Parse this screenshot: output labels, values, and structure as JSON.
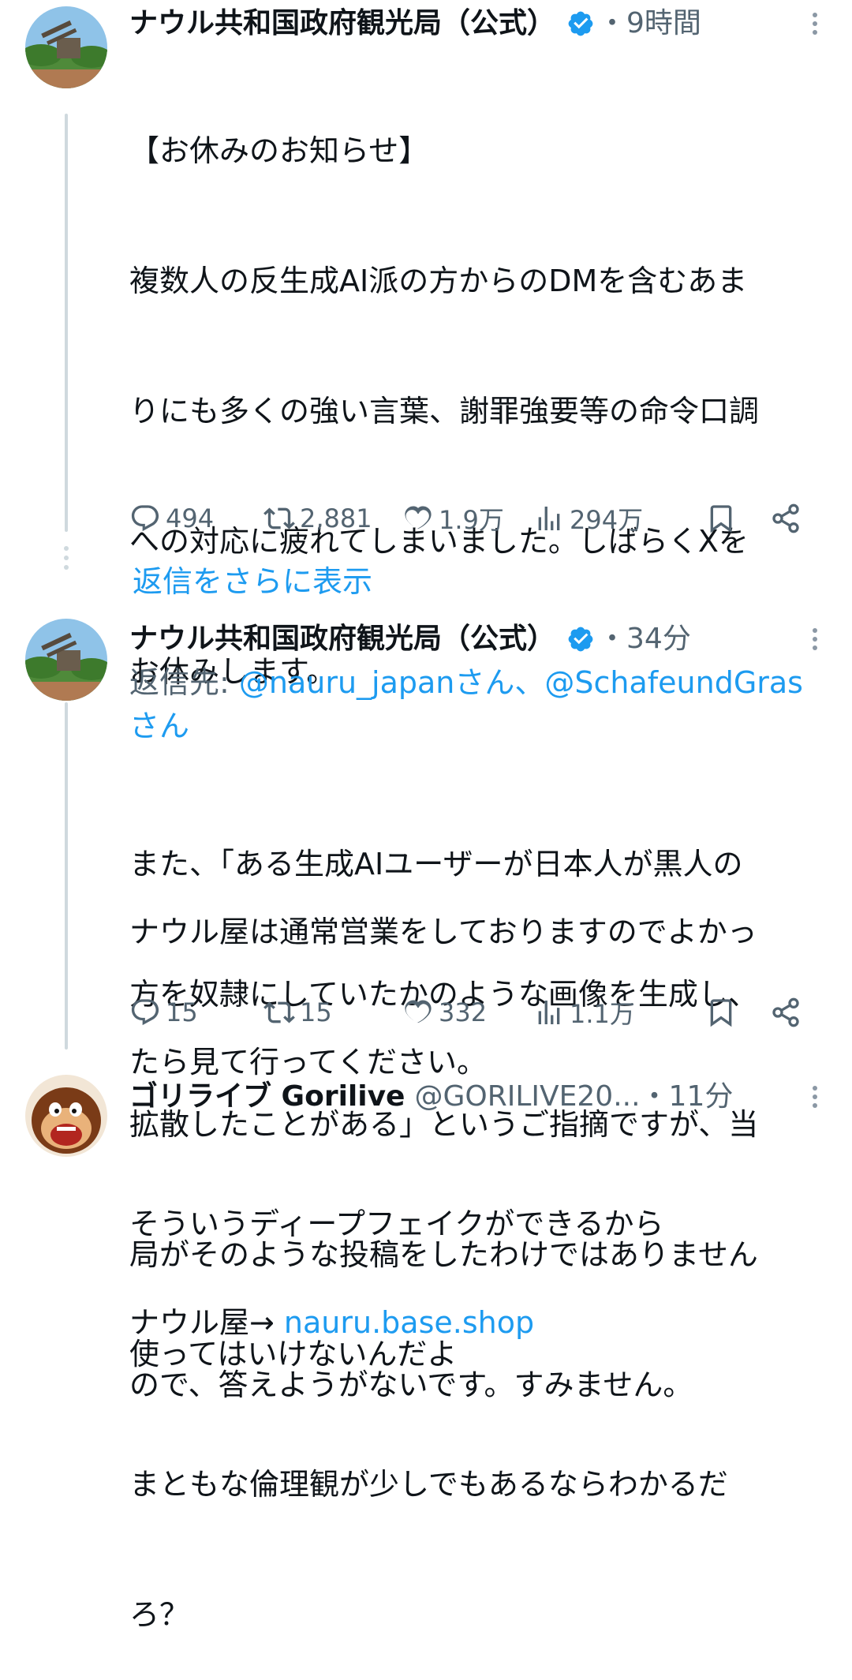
{
  "tweets": [
    {
      "display_name": "ナウル共和国政府観光局（公式）",
      "verified": true,
      "time": "・9時間",
      "lines": [
        "【お休みのお知らせ】",
        "複数人の反生成AI派の方からのDMを含むあま",
        "りにも多くの強い言葉、謝罪強要等の命令口調",
        "への対応に疲れてしまいました。しばらくXを",
        "お休みします。",
        "",
        "ナウル屋は通常営業をしておりますのでよかっ",
        "たら見て行ってください。",
        "",
        "ナウル屋→ "
      ],
      "link": "nauru.base.shop",
      "replies": "494",
      "retweets": "2,881",
      "likes": "1.9万",
      "views": "294万"
    },
    {
      "display_name": "ナウル共和国政府観光局（公式）",
      "verified": true,
      "time": "・34分",
      "reply_prefix": "返信先: ",
      "reply_mentions_1": "@nauru_japanさん、@SchafeundGras",
      "reply_mentions_2": "さん",
      "lines": [
        "また、「ある生成AIユーザーが日本人が黒人の",
        "方を奴隷にしていたかのような画像を生成し、",
        "拡散したことがある」というご指摘ですが、当",
        "局がそのような投稿をしたわけではありません",
        "ので、答えようがないです。すみません。"
      ],
      "replies": "15",
      "retweets": "15",
      "likes": "332",
      "views": "1.1万"
    },
    {
      "display_name": "ゴリライブ Gorilive",
      "handle": "@GORILIVE20...",
      "time": "・11分",
      "lines": [
        "そういうディープフェイクができるから",
        "使ってはいけないんだよ",
        "まともな倫理観が少しでもあるならわかるだ",
        "ろ？"
      ]
    }
  ],
  "show_more_replies": "返信をさらに表示",
  "colors": {
    "accent": "#1d9bf0",
    "text": "#0f1419",
    "muted": "#536471",
    "thread": "#cfd9de"
  }
}
